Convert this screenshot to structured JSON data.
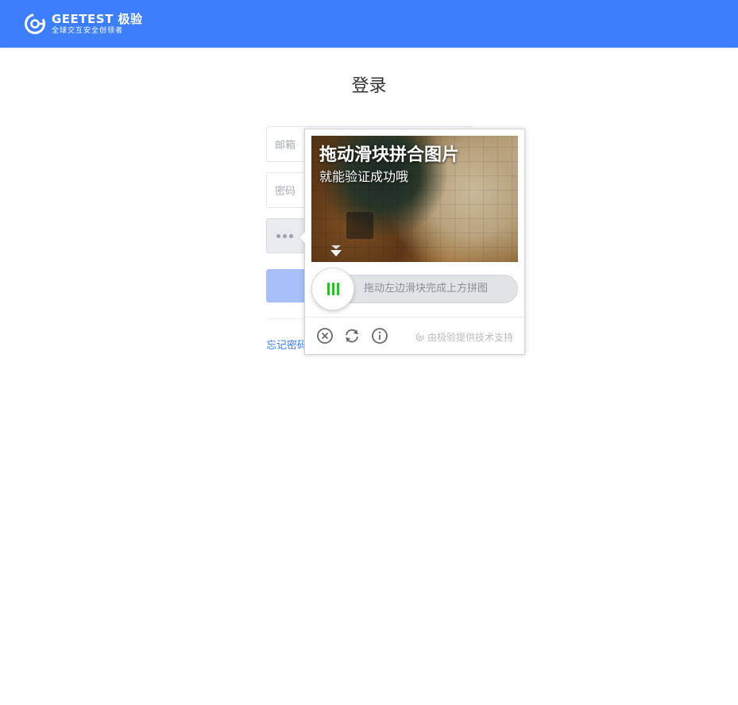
{
  "header": {
    "brand_name": "GEETEST 极验",
    "brand_tagline": "全球交互安全创领者",
    "background_color": "#3c7efc"
  },
  "page": {
    "title": "登录"
  },
  "form": {
    "email_placeholder": "邮箱",
    "password_placeholder": "密码",
    "forgot_password_partial": "忘记密码"
  },
  "captcha": {
    "image_title": "拖动滑块拼合图片",
    "image_subtitle": "就能验证成功哦",
    "slider_hint": "拖动左边滑块完成上方拼图",
    "powered_by": "由极验提供技术支持",
    "icons": {
      "close": "close-circle-icon",
      "refresh": "refresh-icon",
      "info": "info-icon",
      "brand": "geetest-logo-icon",
      "expand": "expand-down-icon"
    },
    "grip_color": "#2fbd2f"
  }
}
